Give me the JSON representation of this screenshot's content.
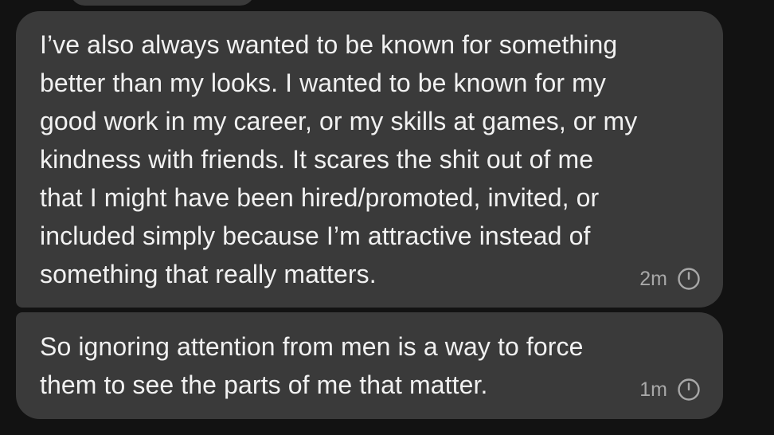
{
  "messages": [
    {
      "text": "I’ve also always wanted to be known for something\nbetter than my looks. I wanted to be known for my\ngood work in my career, or my skills at games, or my\nkindness with friends. It scares the shit out of me\nthat I might have been hired/promoted, invited, or\nincluded simply because I’m attractive instead of\nsomething that really matters.",
      "time": "2m",
      "status_icon": "clock-icon"
    },
    {
      "text": "So ignoring attention from men is a way to force\nthem to see the parts of me that matter.",
      "time": "1m",
      "status_icon": "clock-icon"
    }
  ],
  "colors": {
    "background": "#121212",
    "bubble": "#3a3a3a",
    "text": "#f1f1f1",
    "meta": "#a8a8a8"
  }
}
